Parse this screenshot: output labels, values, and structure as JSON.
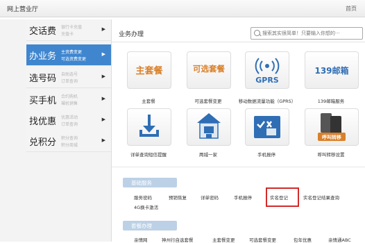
{
  "header": {
    "title": "网上营业厅",
    "home": "首页"
  },
  "sidebar": {
    "items": [
      {
        "label": "交话费",
        "sub1": "银行卡充值",
        "sub2": "充值卡"
      },
      {
        "label": "办业务",
        "sub1": "主资费变更",
        "sub2": "可选资费变更"
      },
      {
        "label": "选号码",
        "sub1": "自助选号",
        "sub2": "订单查询"
      },
      {
        "label": "买手机",
        "sub1": "合约购机",
        "sub2": "裸机销售"
      },
      {
        "label": "找优惠",
        "sub1": "优惠活动",
        "sub2": "订单查询"
      },
      {
        "label": "兑积分",
        "sub1": "积分查询",
        "sub2": "积分商城"
      }
    ]
  },
  "main": {
    "title": "业务办理",
    "search": {
      "placeholder": "搜索其实很简单！只要输入你想的···"
    },
    "tiles": [
      {
        "text": "主套餐",
        "label": "主套餐"
      },
      {
        "text": "可选套餐",
        "label": "可选套餐变更"
      },
      {
        "text": "GPRS",
        "label": "移动数据流量功能（GPRS）"
      },
      {
        "text": "139邮箱",
        "label": "139邮箱服务"
      },
      {
        "label": "详单查询短信提醒"
      },
      {
        "label": "两城一家"
      },
      {
        "label": "手机报停"
      },
      {
        "text": "呼叫转移",
        "label": "呼叫转移设置"
      }
    ],
    "basic": {
      "title": "基础服务",
      "links": [
        "服务密码",
        "预销恢复",
        "详单密码",
        "手机报停",
        "实名登记",
        "实名登记结果查询",
        "4G换卡激活"
      ]
    },
    "plans": {
      "title": "套餐办理",
      "links": [
        "亲情网",
        "神州行自选套餐",
        "主套餐变更",
        "可选套餐变更",
        "包年优惠",
        "亲情通ABC"
      ]
    }
  },
  "colors": {
    "accent": "#3f86cf",
    "highlight": "#d12b2b",
    "tile_orange": "#d9802a",
    "tile_blue": "#2f6eb5"
  }
}
